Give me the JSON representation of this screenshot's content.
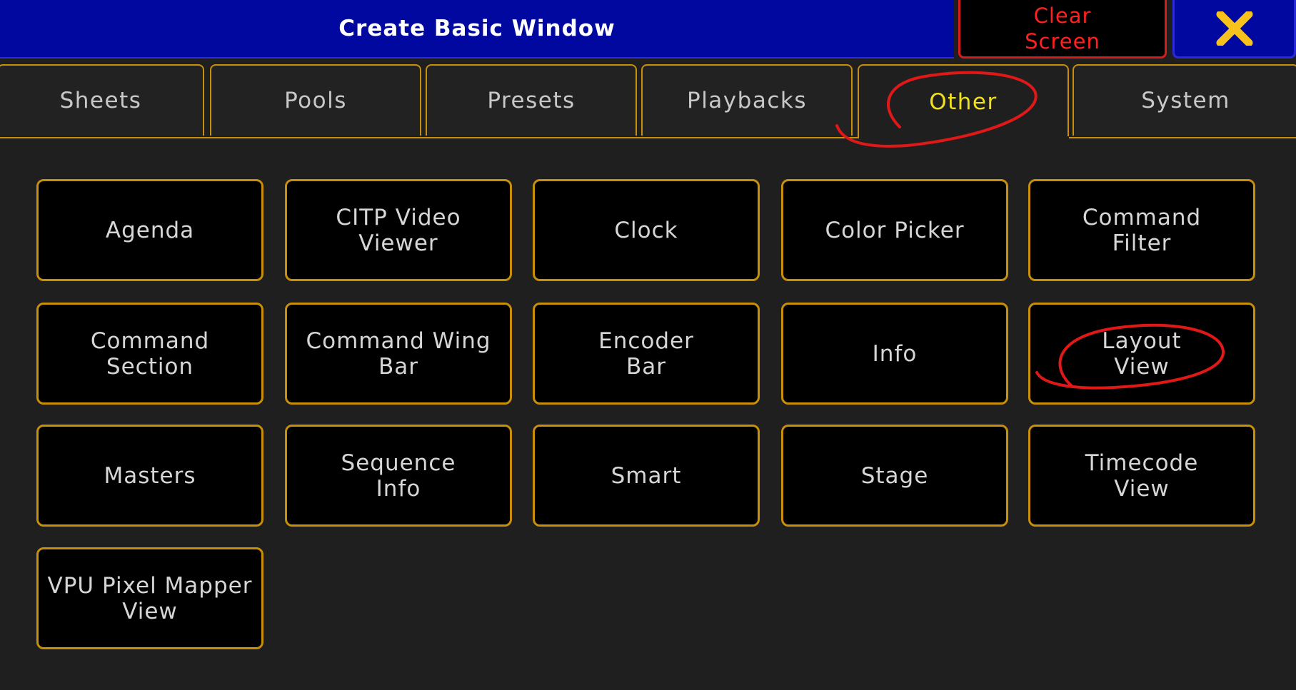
{
  "window": {
    "title": "Create Basic Window",
    "clear_label_line1": "Clear",
    "clear_label_line2": "Screen",
    "close_icon": "close-x-icon"
  },
  "tabs": [
    {
      "label": "Sheets",
      "active": false
    },
    {
      "label": "Pools",
      "active": false
    },
    {
      "label": "Presets",
      "active": false
    },
    {
      "label": "Playbacks",
      "active": false
    },
    {
      "label": "Other",
      "active": true
    },
    {
      "label": "System",
      "active": false
    }
  ],
  "buttons": [
    {
      "label": "Agenda"
    },
    {
      "label": "CITP Video\nViewer"
    },
    {
      "label": "Clock"
    },
    {
      "label": "Color Picker"
    },
    {
      "label": "Command\nFilter"
    },
    {
      "label": "Command\nSection"
    },
    {
      "label": "Command Wing\nBar"
    },
    {
      "label": "Encoder\nBar"
    },
    {
      "label": "Info"
    },
    {
      "label": "Layout\nView"
    },
    {
      "label": "Masters"
    },
    {
      "label": "Sequence\nInfo"
    },
    {
      "label": "Smart"
    },
    {
      "label": "Stage"
    },
    {
      "label": "Timecode\nView"
    },
    {
      "label": "VPU Pixel Mapper\nView"
    }
  ],
  "colors": {
    "title_bg": "#0008a0",
    "accent_border": "#c8900a",
    "active_tab_text": "#f0e020",
    "clear_text": "#ff2020",
    "close_icon": "#f7c21c",
    "annotation": "#e01818"
  }
}
